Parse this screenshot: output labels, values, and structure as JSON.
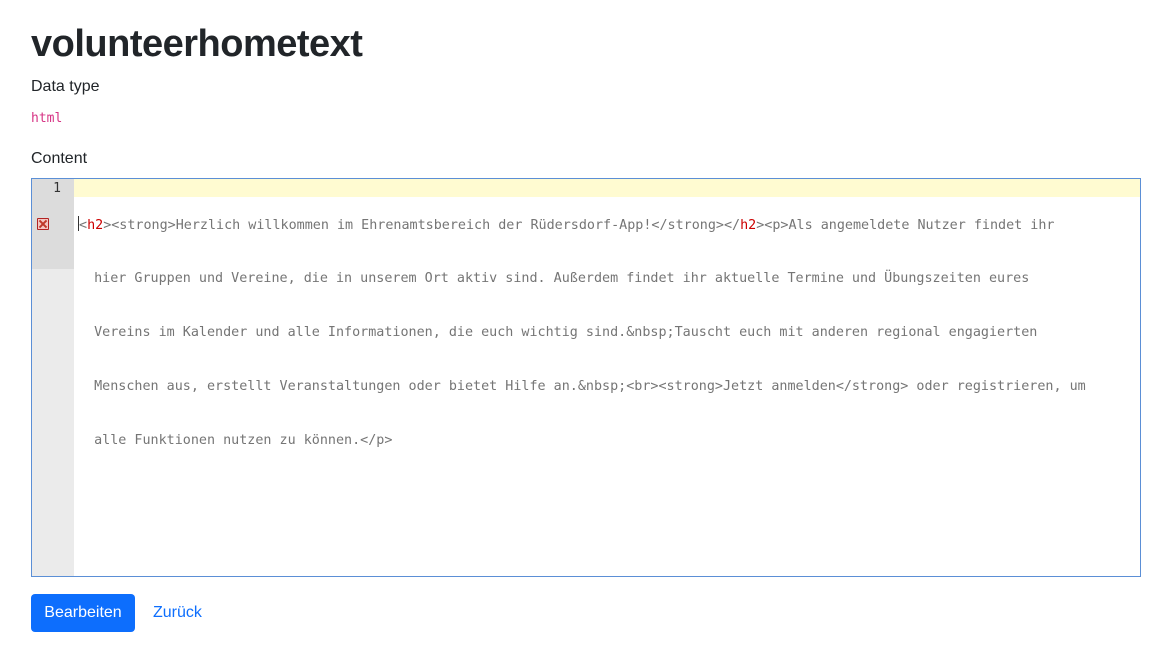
{
  "page": {
    "title": "volunteerhometext"
  },
  "data_type": {
    "label": "Data type",
    "value": "html"
  },
  "content": {
    "label": "Content",
    "editor": {
      "line_number": "1",
      "error_marker": "error-icon",
      "lines": {
        "l1": {
          "a": "<",
          "b": "h2",
          "c": "><strong>Herzlich willkommen im Ehrenamtsbereich der Rüdersdorf-App!</strong></",
          "d": "h2",
          "e": "><p>Als angemeldete Nutzer findet ihr"
        },
        "l2": "  hier Gruppen und Vereine, die in unserem Ort aktiv sind. Außerdem findet ihr aktuelle Termine und Übungszeiten eures",
        "l3": "  Vereins im Kalender und alle Informationen, die euch wichtig sind.&nbsp;Tauscht euch mit anderen regional engagierten",
        "l4": "  Menschen aus, erstellt Veranstaltungen oder bietet Hilfe an.&nbsp;<br><strong>Jetzt anmelden</strong> oder registrieren, um",
        "l5": "  alle Funktionen nutzen zu können.</p>"
      }
    }
  },
  "actions": {
    "edit_label": "Bearbeiten",
    "back_label": "Zurück"
  },
  "colors": {
    "primary": "#0d6efd",
    "code_pink": "#d63384",
    "tag_red": "#cc0000",
    "active_line": "#fffbd1",
    "editor_border": "#5b8fd6"
  }
}
